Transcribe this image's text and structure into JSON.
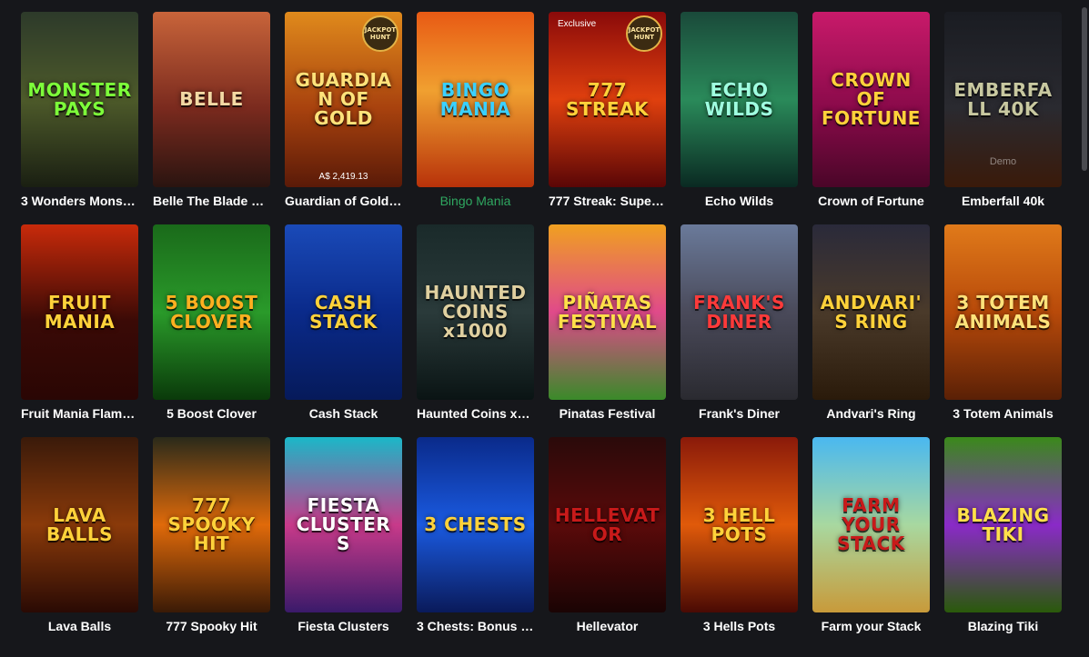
{
  "games": [
    {
      "name": "3 Wonders Monst…",
      "art": "MONSTER PAYS",
      "bg": "linear-gradient(180deg,#2d3a2a 0%,#4d5a2a 50%,#1a1f12 100%)",
      "color": "#7dff3a"
    },
    {
      "name": "Belle The Blade H…",
      "art": "BELLE",
      "bg": "linear-gradient(180deg,#c8643a 0%,#7a2a1e 55%,#2a1410 100%)",
      "color": "#f3d9a4"
    },
    {
      "name": "Guardian of Gold: …",
      "art": "GUARDIAN OF GOLD",
      "bg": "linear-gradient(180deg,#e08a1c 0%,#a8420e 55%,#5a1a08 100%)",
      "color": "#ffe27a",
      "jackpot": "JACKPOT HUNT",
      "amount": "A$ 2,419.13"
    },
    {
      "name": "Bingo Mania",
      "art": "BINGO MANIA",
      "bg": "linear-gradient(180deg,#e85a14 0%,#f0a030 45%,#b8320a 100%)",
      "color": "#3ad0ff",
      "active": true
    },
    {
      "name": "777 Streak: Super…",
      "art": "777 STREAK",
      "bg": "linear-gradient(180deg,#8a0a0a 0%,#e0400e 50%,#5a0606 100%)",
      "color": "#ffd23a",
      "jackpot": "JACKPOT HUNT",
      "exclusive": "Exclusive"
    },
    {
      "name": "Echo Wilds",
      "art": "ECHO WILDS",
      "bg": "linear-gradient(180deg,#1a4a3a 0%,#2a8a5a 50%,#0a2a22 100%)",
      "color": "#9fffe0"
    },
    {
      "name": "Crown of Fortune",
      "art": "CROWN OF FORTUNE",
      "bg": "linear-gradient(180deg,#c81a6a 0%,#8a0a4a 55%,#4a0628 100%)",
      "color": "#ffd23a"
    },
    {
      "name": "Emberfall 40k",
      "art": "EMBERFALL 40K",
      "bg": "linear-gradient(180deg,#1a1c22 0%,#2a2a30 55%,#3a1a0a 100%)",
      "color": "#c8c8a0",
      "demo": "Demo"
    },
    {
      "name": "Fruit Mania Flami…",
      "art": "FRUIT MANIA",
      "bg": "linear-gradient(180deg,#c82a0a 0%,#3a0a06 55%,#2a0604 100%)",
      "color": "#ffd23a"
    },
    {
      "name": "5 Boost Clover",
      "art": "5 BOOST CLOVER",
      "bg": "linear-gradient(180deg,#1a6a1a 0%,#2a9a2a 50%,#0a3a0a 100%)",
      "color": "#ffb020"
    },
    {
      "name": "Cash Stack",
      "art": "CASH STACK",
      "bg": "linear-gradient(180deg,#1a4ab8 0%,#0a2a8a 50%,#061a5a 100%)",
      "color": "#ffd23a"
    },
    {
      "name": "Haunted Coins x1…",
      "art": "HAUNTED COINS x1000",
      "bg": "linear-gradient(180deg,#1a2a2a 0%,#2a3a3a 50%,#0a1414 100%)",
      "color": "#e0d0a0"
    },
    {
      "name": "Pinatas Festival",
      "art": "PIÑATAS FESTIVAL",
      "bg": "linear-gradient(180deg,#f0a020 0%,#e04a8a 50%,#3a8a2a 100%)",
      "color": "#ffe04a"
    },
    {
      "name": "Frank's Diner",
      "art": "FRANK'S DINER",
      "bg": "linear-gradient(180deg,#6a7a9a 0%,#4a4a5a 50%,#2a2a30 100%)",
      "color": "#ff3a3a"
    },
    {
      "name": "Andvari's Ring",
      "art": "ANDVARI'S RING",
      "bg": "linear-gradient(180deg,#2a2a3a 0%,#4a3a2a 50%,#2a1a0a 100%)",
      "color": "#ffd23a"
    },
    {
      "name": "3 Totem Animals",
      "art": "3 TOTEM ANIMALS",
      "bg": "linear-gradient(180deg,#e07a1a 0%,#b84a0a 50%,#5a2006 100%)",
      "color": "#ffe27a"
    },
    {
      "name": "Lava Balls",
      "art": "LAVA BALLS",
      "bg": "linear-gradient(180deg,#3a1a0a 0%,#8a3a0a 50%,#2a0a04 100%)",
      "color": "#ffd23a"
    },
    {
      "name": "777 Spooky Hit",
      "art": "777 SPOOKY HIT",
      "bg": "linear-gradient(180deg,#2a2a1a 0%,#e06a0a 50%,#3a1a06 100%)",
      "color": "#ffd23a"
    },
    {
      "name": "Fiesta Clusters",
      "art": "FIESTA CLUSTERS",
      "bg": "linear-gradient(180deg,#1ab8c8 0%,#c83a8a 50%,#3a1a6a 100%)",
      "color": "#ffffff"
    },
    {
      "name": "3 Chests: Bonus C…",
      "art": "3 CHESTS",
      "bg": "linear-gradient(180deg,#0a2a8a 0%,#1a5ae0 50%,#0a1a5a 100%)",
      "color": "#ffd23a"
    },
    {
      "name": "Hellevator",
      "art": "HELLEVATOR",
      "bg": "linear-gradient(180deg,#2a0a0a 0%,#5a0a0a 50%,#1a0404 100%)",
      "color": "#c81a1a"
    },
    {
      "name": "3 Hells Pots",
      "art": "3 HELL POTS",
      "bg": "linear-gradient(180deg,#8a1a0a 0%,#e05a0a 50%,#4a0a04 100%)",
      "color": "#ffd23a"
    },
    {
      "name": "Farm your Stack",
      "art": "FARM YOUR STACK",
      "bg": "linear-gradient(180deg,#4ab8f0 0%,#a8d8a0 50%,#c89a3a 100%)",
      "color": "#c81a1a"
    },
    {
      "name": "Blazing Tiki",
      "art": "BLAZING TIKI",
      "bg": "linear-gradient(180deg,#3a8a1a 0%,#8a2ac8 50%,#2a5a0a 100%)",
      "color": "#ffe04a"
    }
  ]
}
